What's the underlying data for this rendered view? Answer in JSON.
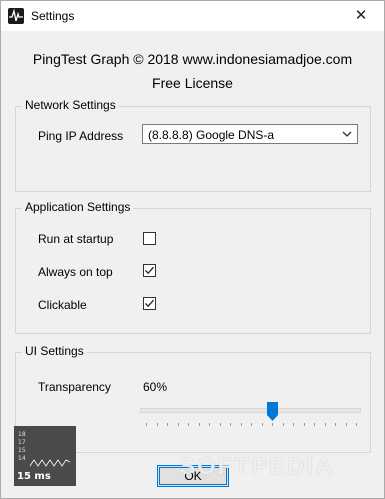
{
  "window": {
    "title": "Settings",
    "close_glyph": "✕",
    "app_icon": "pulse-icon"
  },
  "header": {
    "credit": "PingTest Graph © 2018 www.indonesiamadjoe.com",
    "license": "Free License"
  },
  "network": {
    "title": "Network Settings",
    "ping_label": "Ping IP Address",
    "ping_value": "(8.8.8.8) Google DNS-a"
  },
  "application": {
    "title": "Application Settings",
    "items": [
      {
        "label": "Run at startup",
        "checked": false
      },
      {
        "label": "Always on top",
        "checked": true
      },
      {
        "label": "Clickable",
        "checked": true
      }
    ]
  },
  "ui": {
    "title": "UI Settings",
    "transparency_label": "Transparency",
    "transparency_value": "60%",
    "transparency_level": 0.6
  },
  "buttons": {
    "ok": "OK"
  },
  "mini_graph": {
    "y_labels": [
      "18",
      "17",
      "15",
      "14"
    ],
    "latency": "15 ms",
    "background": "#4a4a4a",
    "line_color": "#ffffff"
  },
  "watermark": "SOFTPEDIA",
  "colors": {
    "accent": "#0078d7",
    "window_bg": "#f0f0f0",
    "titlebar_bg": "#ffffff"
  }
}
